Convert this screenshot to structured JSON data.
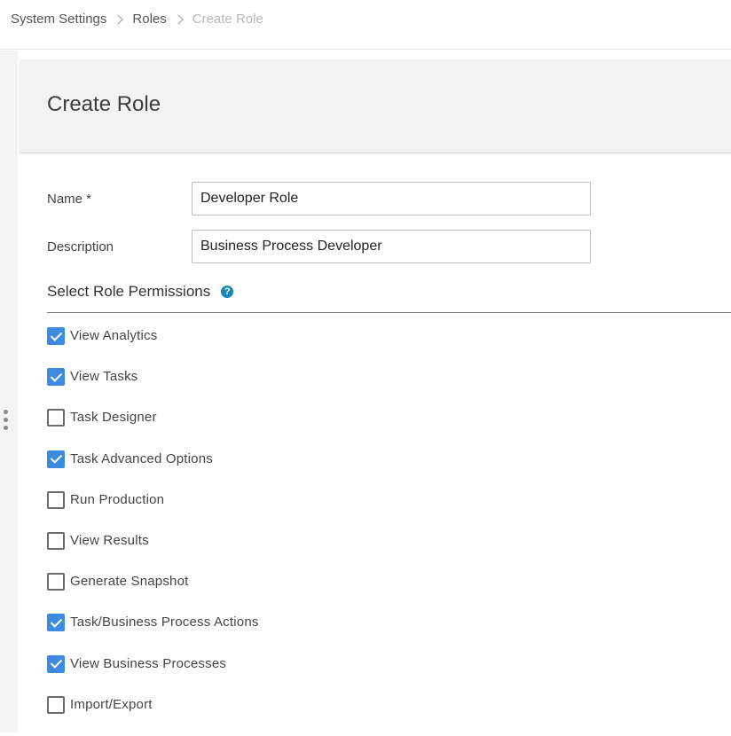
{
  "breadcrumb": {
    "items": [
      {
        "label": "System Settings"
      },
      {
        "label": "Roles"
      },
      {
        "label": "Create Role"
      }
    ]
  },
  "page": {
    "title": "Create Role"
  },
  "form": {
    "name": {
      "label": "Name *",
      "value": "Developer Role"
    },
    "description": {
      "label": "Description",
      "value": "Business Process Developer"
    }
  },
  "permissions": {
    "title": "Select Role Permissions",
    "help_icon": "question-circle-icon",
    "help_glyph": "?",
    "items": [
      {
        "label": "View Analytics",
        "checked": true
      },
      {
        "label": "View Tasks",
        "checked": true
      },
      {
        "label": "Task Designer",
        "checked": false
      },
      {
        "label": "Task Advanced Options",
        "checked": true
      },
      {
        "label": "Run Production",
        "checked": false
      },
      {
        "label": "View Results",
        "checked": false
      },
      {
        "label": "Generate Snapshot",
        "checked": false
      },
      {
        "label": "Task/Business Process Actions",
        "checked": true
      },
      {
        "label": "View Business Processes",
        "checked": true
      },
      {
        "label": "Import/Export",
        "checked": false
      }
    ]
  },
  "colors": {
    "checkbox_checked": "#3d8be0",
    "help_icon": "#1a86b8",
    "breadcrumb_current": "#b8b8b8"
  }
}
